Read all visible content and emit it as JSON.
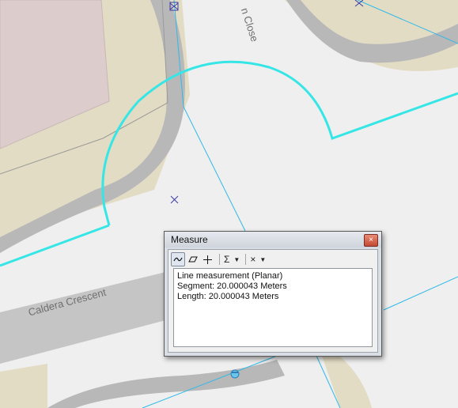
{
  "map": {
    "street_labels": {
      "caldera": "Caldera Crescent",
      "close": "n Close"
    }
  },
  "measure": {
    "title": "Measure",
    "close_glyph": "×",
    "toolbar": {
      "line_tool": "line-measure-icon",
      "area_tool": "area-measure-icon",
      "feature_tool": "crosshair-icon",
      "sum_label": "Σ",
      "clear_label": "×"
    },
    "output": {
      "line1": "Line measurement (Planar)",
      "line2": "Segment: 20.000043 Meters",
      "line3": "Length: 20.000043 Meters"
    }
  }
}
